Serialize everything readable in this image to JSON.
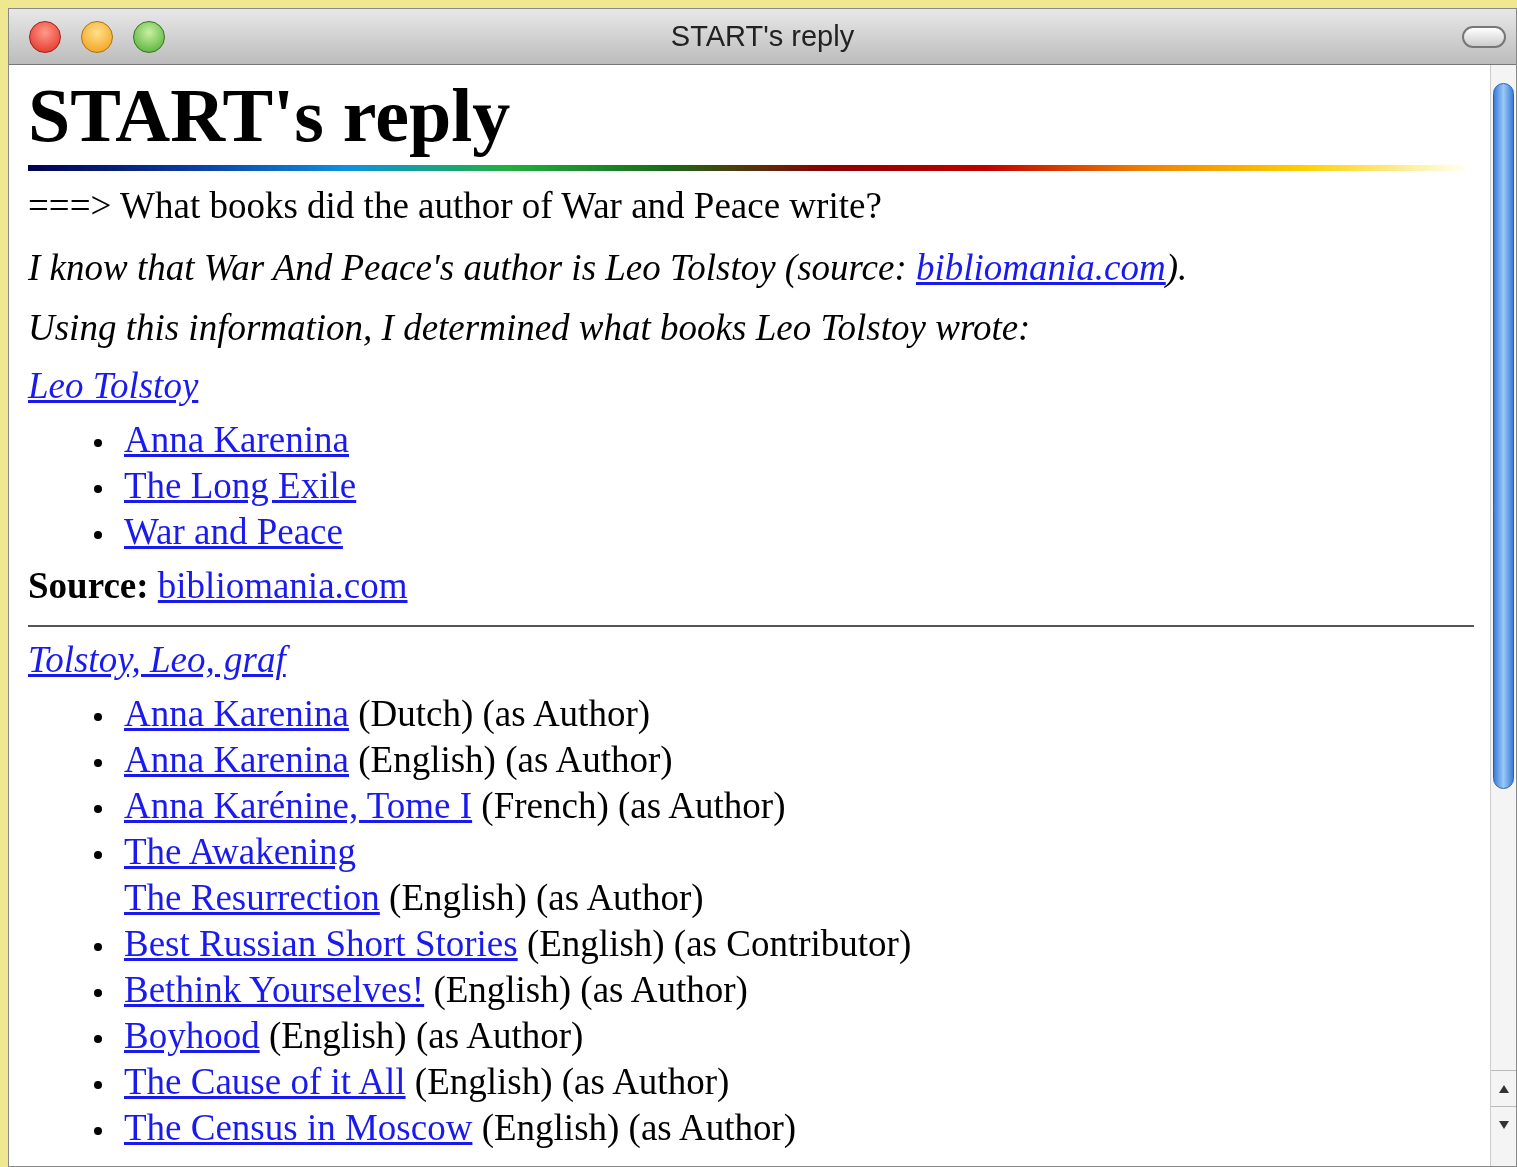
{
  "window": {
    "title": "START's reply"
  },
  "heading": "START's reply",
  "question": "===> What books did the author of War and Peace write?",
  "known": {
    "text_before": "I know that War And Peace's author is Leo Tolstoy (source: ",
    "link": "bibliomania.com",
    "text_after": ")."
  },
  "reasoning": "Using this information, I determined what books Leo Tolstoy wrote:",
  "sections": [
    {
      "author_link": "Leo Tolstoy",
      "books": [
        {
          "title": "Anna Karenina"
        },
        {
          "title": "The Long Exile"
        },
        {
          "title": "War and Peace"
        }
      ],
      "source": {
        "label": "Source:",
        "link": "bibliomania.com"
      }
    },
    {
      "author_link": "Tolstoy, Leo, graf",
      "books": [
        {
          "title": "Anna Karenina",
          "details": "(Dutch) (as Author)"
        },
        {
          "title": "Anna Karenina",
          "details": "(English) (as Author)"
        },
        {
          "title": "Anna Karénine, Tome I",
          "details": "(French) (as Author)"
        },
        {
          "title": "The Awakening",
          "continuation": {
            "title": "The Resurrection",
            "details": "(English) (as Author)"
          }
        },
        {
          "title": "Best Russian Short Stories",
          "details": "(English) (as Contributor)"
        },
        {
          "title": "Bethink Yourselves!",
          "details": "(English) (as Author)"
        },
        {
          "title": "Boyhood",
          "details": "(English) (as Author)"
        },
        {
          "title": "The Cause of it All",
          "details": "(English) (as Author)"
        },
        {
          "title": "The Census in Moscow",
          "details": "(English) (as Author)"
        }
      ]
    }
  ]
}
